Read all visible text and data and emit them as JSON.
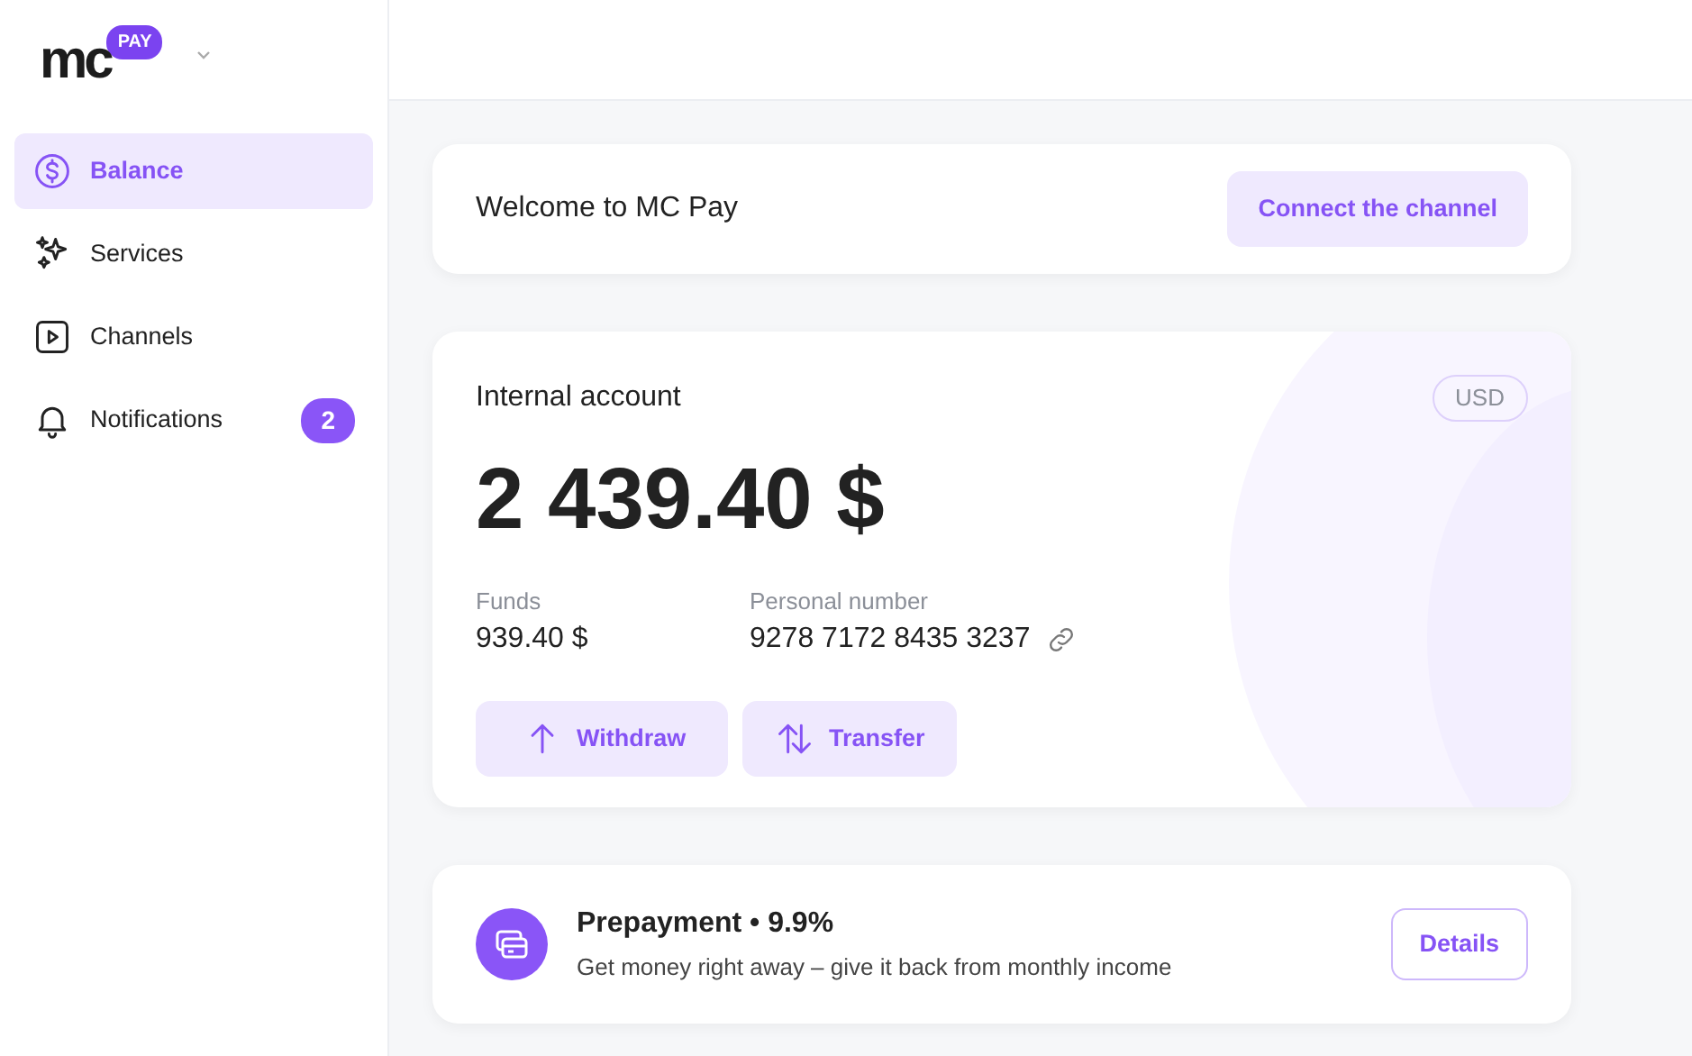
{
  "logo": {
    "text": "mc",
    "badge": "PAY"
  },
  "sidebar": {
    "items": [
      {
        "kind": "balance",
        "label": "Balance",
        "selected": true
      },
      {
        "kind": "services",
        "label": "Services",
        "selected": false
      },
      {
        "kind": "channels",
        "label": "Channels",
        "selected": false
      },
      {
        "kind": "notifications",
        "label": "Notifications",
        "selected": false,
        "badge": "2"
      }
    ]
  },
  "welcome": {
    "title": "Welcome to MC Pay",
    "button": "Connect the channel"
  },
  "account": {
    "title": "Internal account",
    "currency": "USD",
    "balance": "2 439.40 $",
    "funds_label": "Funds",
    "funds": "939.40 $",
    "number_label": "Personal number",
    "number": "9278 7172 8435 3237",
    "actions": [
      {
        "kind": "withdraw",
        "label": "Withdraw"
      },
      {
        "kind": "transfer",
        "label": "Transfer"
      }
    ]
  },
  "prepayment": {
    "title": "Prepayment • 9.9%",
    "subtitle": "Get money right away – give it back from monthly income",
    "button": "Details"
  }
}
